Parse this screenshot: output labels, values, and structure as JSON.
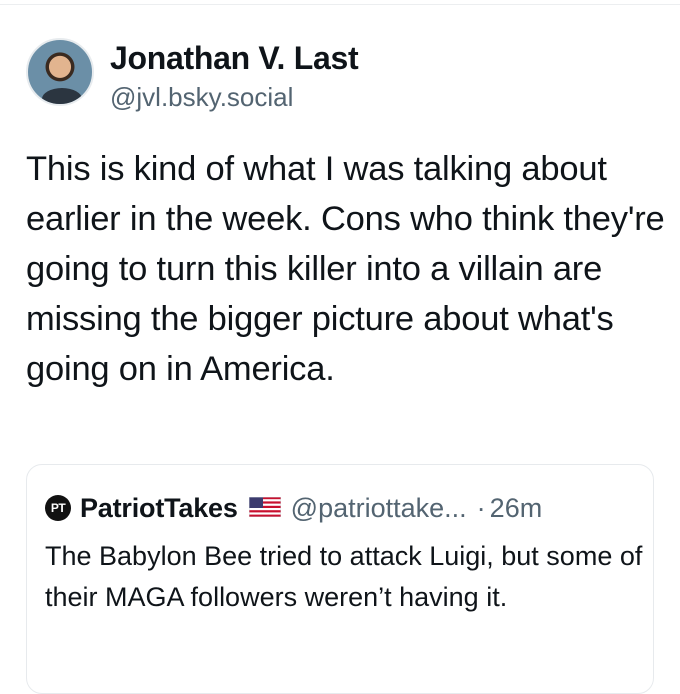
{
  "author": {
    "display_name": "Jonathan V. Last",
    "handle": "@jvl.bsky.social"
  },
  "post": {
    "text": "This is kind of what I was talking about earlier in the week. Cons who think they're going to turn this killer into a villain are missing the bigger picture about what's going on in America."
  },
  "quote": {
    "logo_text": "PT",
    "display_name": "PatriotTakes",
    "flag_icon": "us-flag-icon",
    "handle": "@patriottake...",
    "separator": "·",
    "time": "26m",
    "text": "The Babylon Bee tried to attack Luigi, but some of their MAGA followers weren’t having it."
  }
}
